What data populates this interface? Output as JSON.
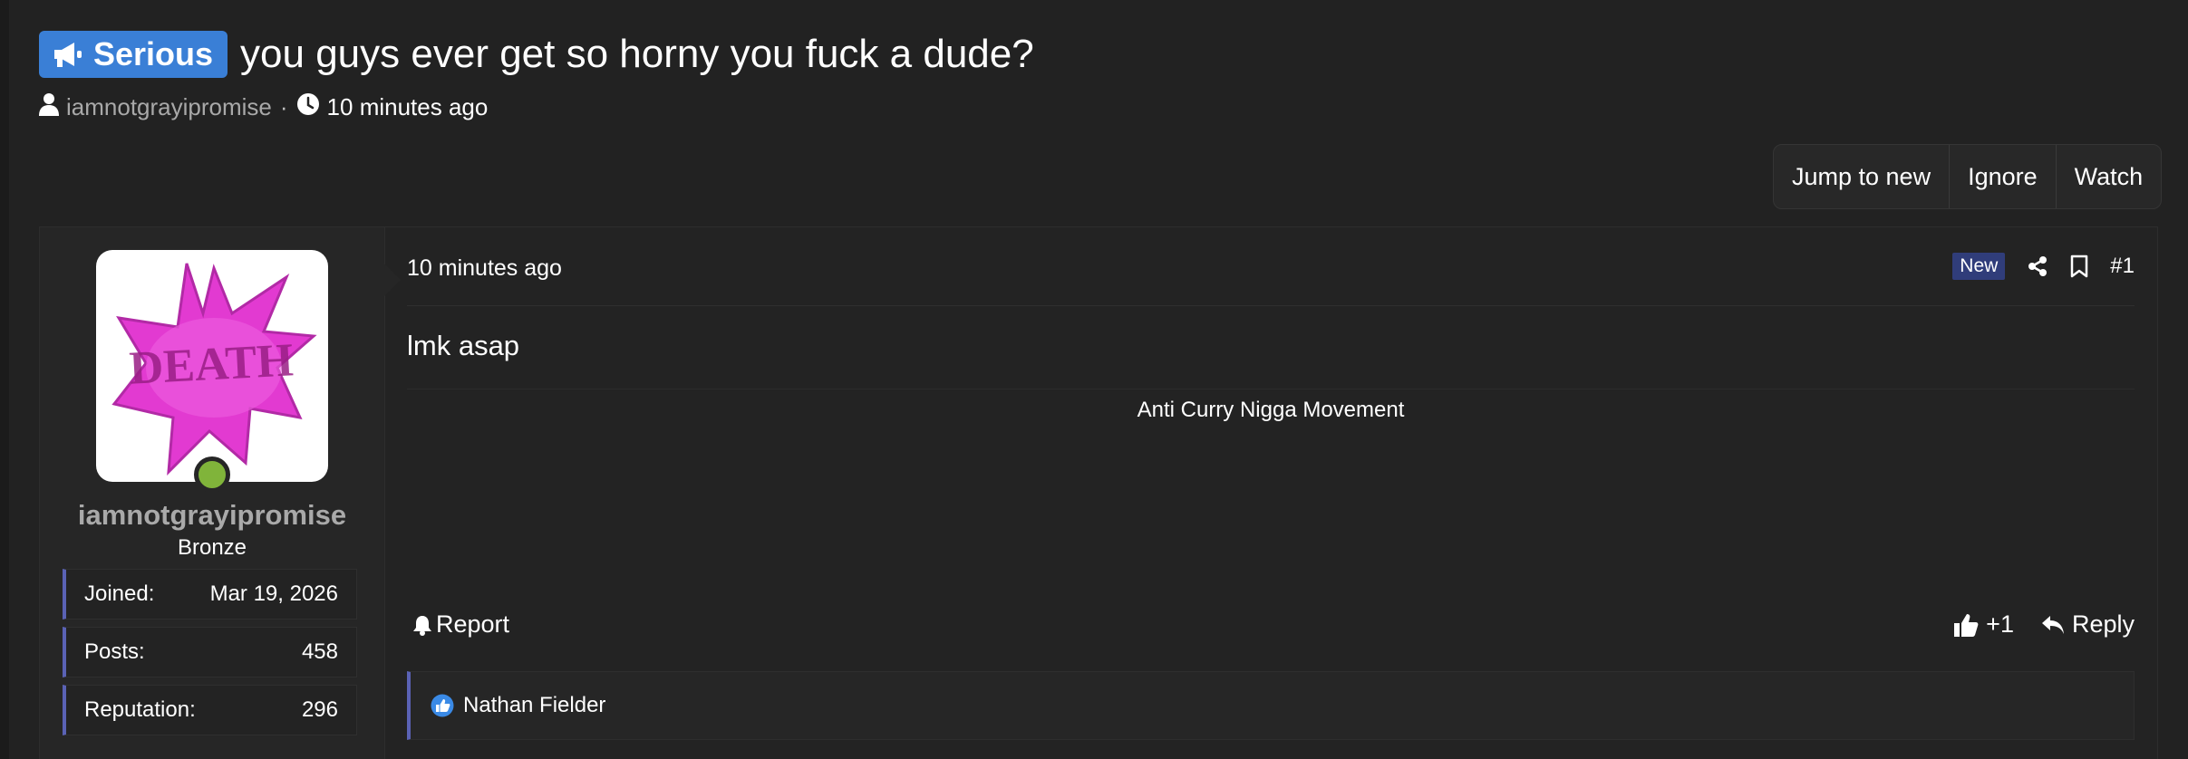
{
  "thread": {
    "prefix": "Serious",
    "title": "you guys ever get so horny you fuck a dude?",
    "author": "iamnotgrayipromise",
    "separator": "·",
    "time": "10 minutes ago"
  },
  "actions": {
    "jump_to_new": "Jump to new",
    "ignore": "Ignore",
    "watch": "Watch"
  },
  "post": {
    "user": {
      "username": "iamnotgrayipromise",
      "rank": "Bronze",
      "avatar_text": "DEATH",
      "online": true,
      "stats": [
        {
          "label": "Joined:",
          "value": "Mar 19, 2026"
        },
        {
          "label": "Posts:",
          "value": "458"
        },
        {
          "label": "Reputation:",
          "value": "296"
        }
      ]
    },
    "date": "10 minutes ago",
    "new_badge": "New",
    "number": "#1",
    "body": "lmk asap",
    "signature": "Anti Curry Nigga Movement",
    "report_label": "Report",
    "reaction_count": "+1",
    "reply_label": "Reply",
    "reacted_by": "Nathan Fielder"
  },
  "colors": {
    "background": "#222222",
    "prefix_blue": "#3a7fd6",
    "accent_border": "#5a62b5",
    "new_badge": "#303d7a",
    "online": "#80b43a",
    "avatar_pink": "#e23ad1"
  },
  "icons": [
    "megaphone-icon",
    "user-icon",
    "clock-icon",
    "share-icon",
    "bookmark-icon",
    "bell-icon",
    "thumbs-up-icon",
    "reply-icon",
    "like-reaction-icon"
  ]
}
